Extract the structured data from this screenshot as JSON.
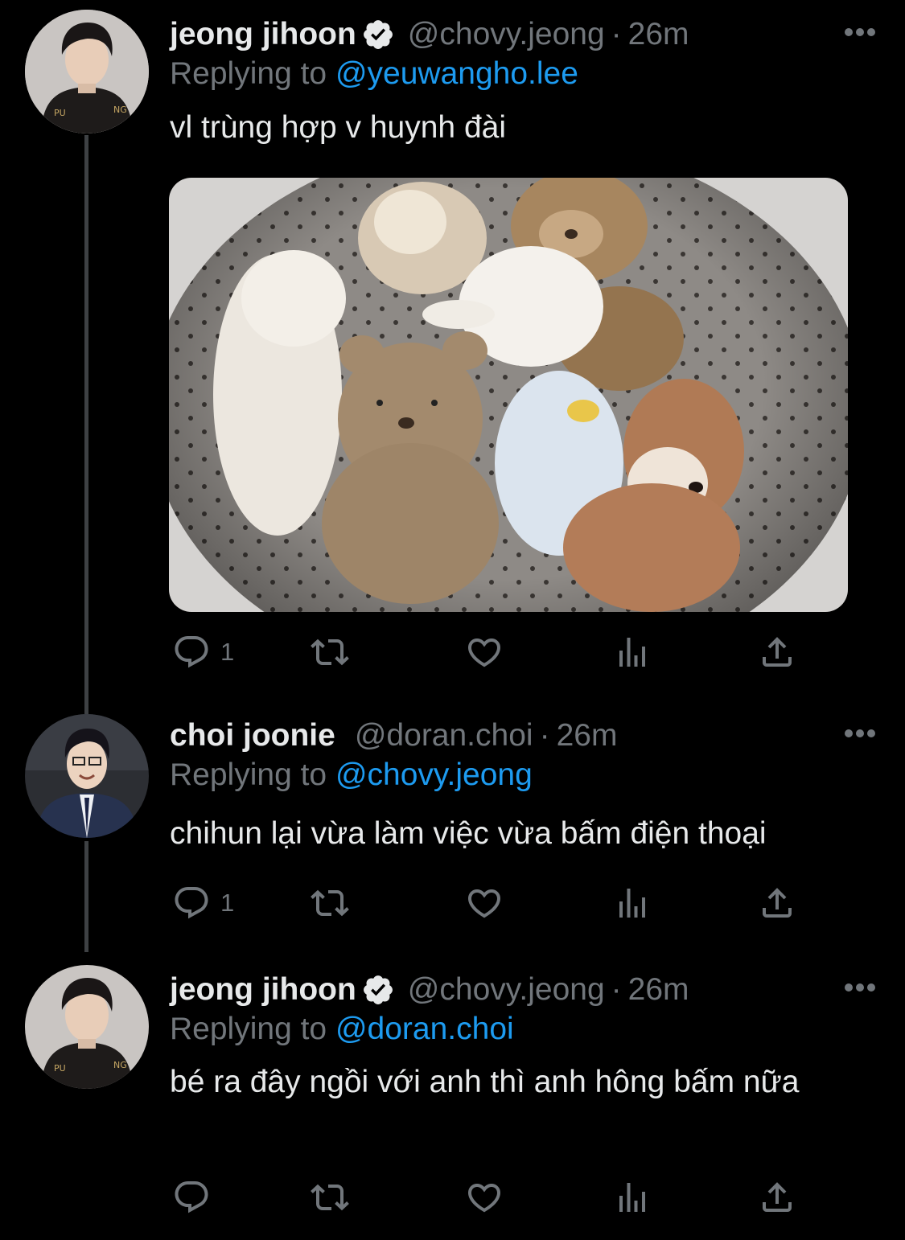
{
  "tweets": [
    {
      "name": "jeong jihoon",
      "handle": "@chovy.jeong",
      "dot": "·",
      "time": "26m",
      "replying_label": "Replying to ",
      "replying_handle": "@yeuwangho.lee",
      "text": "vl trùng hợp v huynh đài",
      "reply_count": "1",
      "verified": true
    },
    {
      "name": "choi joonie",
      "handle": "@doran.choi",
      "dot": "·",
      "time": "26m",
      "replying_label": "Replying to ",
      "replying_handle": "@chovy.jeong",
      "text": "chihun lại vừa làm việc vừa bấm điện thoại",
      "reply_count": "1",
      "verified": false
    },
    {
      "name": "jeong jihoon",
      "handle": "@chovy.jeong",
      "dot": "·",
      "time": "26m",
      "replying_label": "Replying to ",
      "replying_handle": "@doran.choi",
      "text": "bé ra đây ngồi với anh thì anh hông bấm nữa",
      "reply_count": "",
      "verified": true
    }
  ],
  "icons": {
    "reply": "reply-icon",
    "retweet": "retweet-icon",
    "like": "heart-icon",
    "views": "views-icon",
    "share": "share-icon",
    "more": "more-icon",
    "verified": "verified-badge-icon"
  },
  "colors": {
    "background": "#000000",
    "text": "#e7e9ea",
    "secondary": "#71767b",
    "link": "#1d9bf0",
    "thread_line": "#3e4144"
  }
}
